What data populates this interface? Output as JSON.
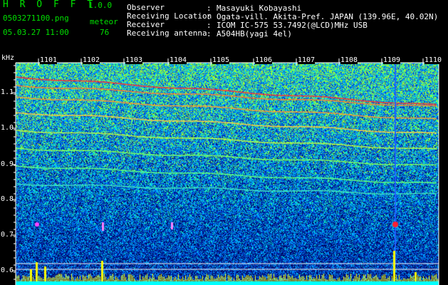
{
  "header": {
    "app_title": "H R O F F T",
    "app_version": "1.0.0",
    "file_name": "0503271100.png",
    "datetime": "05.03.27 11:00",
    "meteor_label": "meteor",
    "meteor_count": "76"
  },
  "metadata": [
    {
      "label": "Observer",
      "value": "Masayuki Kobayashi"
    },
    {
      "label": "Receiving Location",
      "value": "Ogata-vill. Akita-Pref. JAPAN (139.96E, 40.02N)"
    },
    {
      "label": "Receiver",
      "value": "ICOM IC-575 53.7492(@LCD)MHz USB"
    },
    {
      "label": "Receiving antenna",
      "value": "A504HB(yagi 4el)"
    }
  ],
  "colon": ":",
  "axis": {
    "unit": "kHz",
    "freq_ticks": [
      "1.1",
      "1.0",
      "0.9",
      "0.8",
      "0.7",
      "0.6"
    ],
    "time_ticks": [
      "1101",
      "1102",
      "1103",
      "1104",
      "1105",
      "1106",
      "1107",
      "1108",
      "1109",
      "1110"
    ]
  },
  "colors": {
    "title_green": "#00e000",
    "background": "#000000",
    "spectro_low": "#001a8c",
    "spectro_high": "#ff2020",
    "baseline_yellow": "#ffff00",
    "baseline_cyan": "#00ffff"
  }
}
